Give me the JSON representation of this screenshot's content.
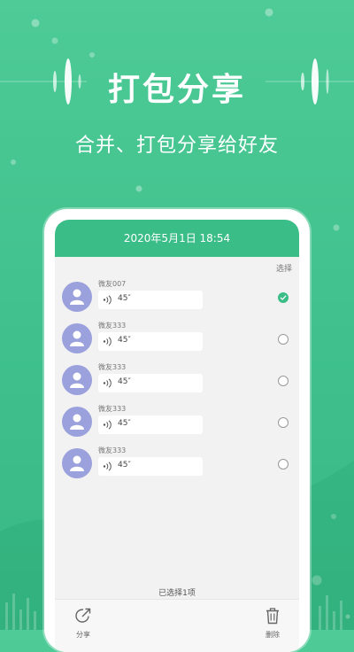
{
  "headline": "打包分享",
  "subline": "合并、打包分享给好友",
  "screen": {
    "datetime": "2020年5月1日  18:54",
    "select_label": "选择",
    "messages": [
      {
        "name": "微友007",
        "duration": "45″",
        "checked": true
      },
      {
        "name": "微友333",
        "duration": "45″",
        "checked": false
      },
      {
        "name": "微友333",
        "duration": "45″",
        "checked": false
      },
      {
        "name": "微友333",
        "duration": "45″",
        "checked": false
      },
      {
        "name": "微友333",
        "duration": "45″",
        "checked": false
      }
    ],
    "selected_count": "已选择1项",
    "toolbar": {
      "share_label": "分享",
      "delete_label": "删除"
    }
  },
  "colors": {
    "accent": "#3bbd88",
    "background": "#4ecb97",
    "avatar": "#9aa1dd"
  },
  "icons": {
    "avatar": "person-icon",
    "voice": "voice-wave-icon",
    "check": "check-icon",
    "share": "share-icon",
    "delete": "trash-icon"
  }
}
